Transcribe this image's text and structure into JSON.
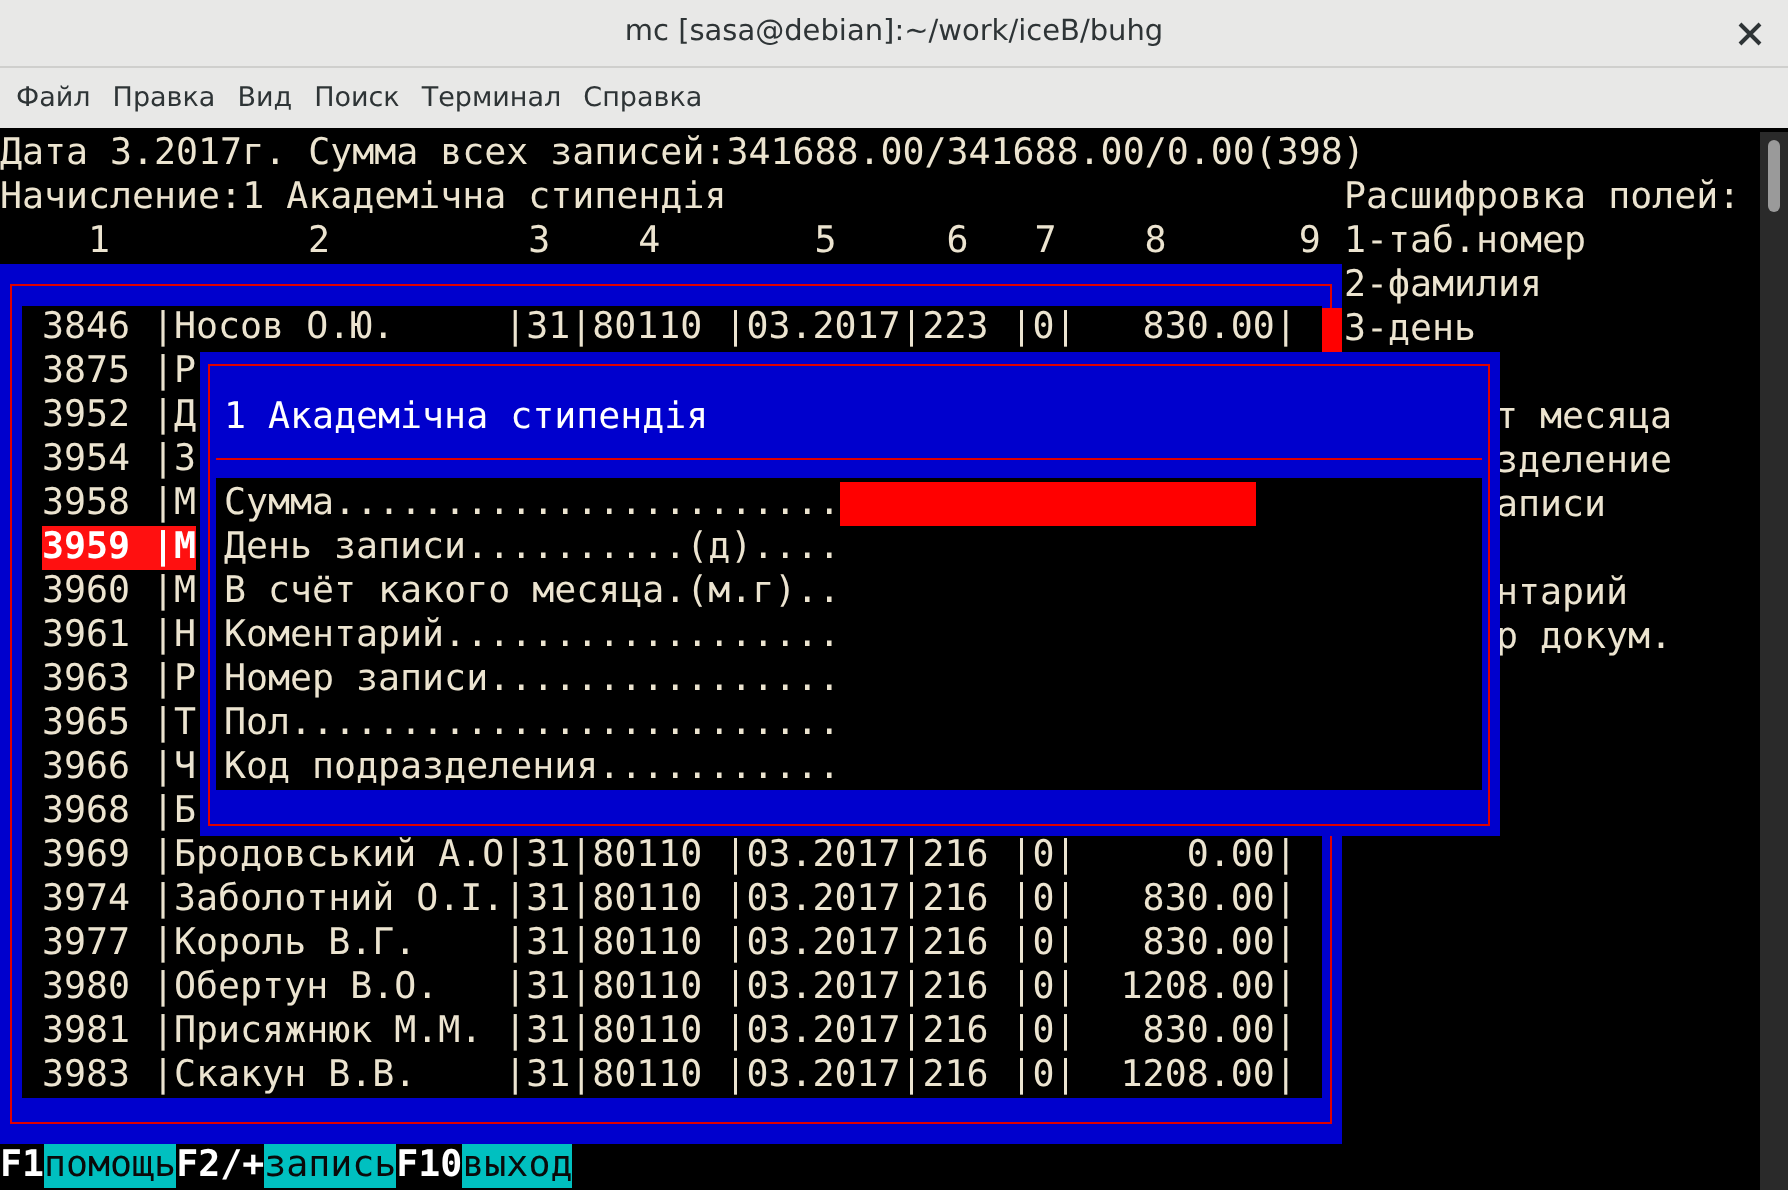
{
  "window": {
    "title": "mc [sasa@debian]:~/work/iceB/buhg"
  },
  "menu": [
    {
      "label": "Файл"
    },
    {
      "label": "Правка"
    },
    {
      "label": "Вид"
    },
    {
      "label": "Поиск"
    },
    {
      "label": "Терминал"
    },
    {
      "label": "Справка"
    }
  ],
  "terminal": {
    "summary": "Дата 3.2017г. Сумма всех записей:341688.00/341688.00/0.00(398)",
    "accrual": "Начисление:1 Академічна стипендія",
    "column_numbers": "1         2         3    4       5     6   7    8      9",
    "legend": [
      {
        "text": "Расшифровка полей:",
        "kind": "full"
      },
      {
        "text": "1-таб.номер",
        "kind": "full"
      },
      {
        "text": "2-фамилия",
        "kind": "full"
      },
      {
        "text": "3-день",
        "kind": "full"
      },
      {
        "text": "т месяца",
        "kind": "clipped"
      },
      {
        "text": "зделение",
        "kind": "clipped"
      },
      {
        "text": "аписи",
        "kind": "clipped"
      },
      {
        "text": "нтарий",
        "kind": "clipped"
      },
      {
        "text": "р докум.",
        "kind": "clipped"
      }
    ],
    "rows": [
      {
        "text": "3846 |Носов О.Ю.     |31|80110 |03.2017|223 |0|   830.00|",
        "selected": false
      },
      {
        "text": "3875 |Р",
        "selected": false
      },
      {
        "text": "3952 |Д",
        "selected": false
      },
      {
        "text": "3954 |З",
        "selected": false
      },
      {
        "text": "3958 |М",
        "selected": false
      },
      {
        "text": "3959 |М",
        "selected": true
      },
      {
        "text": "3960 |М",
        "selected": false
      },
      {
        "text": "3961 |Н",
        "selected": false
      },
      {
        "text": "3963 |Р",
        "selected": false
      },
      {
        "text": "3965 |Т",
        "selected": false
      },
      {
        "text": "3966 |Ч",
        "selected": false
      },
      {
        "text": "3968 |Б",
        "selected": false
      },
      {
        "text": "3969 |Бродовський А.О|31|80110 |03.2017|216 |0|     0.00|",
        "selected": false
      },
      {
        "text": "3974 |Заболотний О.І.|31|80110 |03.2017|216 |0|   830.00|",
        "selected": false
      },
      {
        "text": "3977 |Король В.Г.    |31|80110 |03.2017|216 |0|   830.00|",
        "selected": false
      },
      {
        "text": "3980 |Обертун В.О.   |31|80110 |03.2017|216 |0|  1208.00|",
        "selected": false
      },
      {
        "text": "3981 |Присяжнюк М.М. |31|80110 |03.2017|216 |0|   830.00|",
        "selected": false
      },
      {
        "text": "3983 |Скакун В.В.    |31|80110 |03.2017|216 |0|  1208.00|",
        "selected": false
      }
    ]
  },
  "dialog": {
    "title": "1 Академічна стипендія",
    "fields": [
      {
        "label": "Сумма.......................",
        "focused": true
      },
      {
        "label": "День записи..........(д)....",
        "focused": false
      },
      {
        "label": "В счёт какого месяца.(м.г)..",
        "focused": false
      },
      {
        "label": "Коментарий..................",
        "focused": false
      },
      {
        "label": "Номер записи................",
        "focused": false
      },
      {
        "label": "Пол.........................",
        "focused": false
      },
      {
        "label": "Код подразделения...........",
        "focused": false
      }
    ]
  },
  "function_keys": [
    {
      "key": "F1",
      "action": "помощь"
    },
    {
      "key": "F2/+",
      "action": "запись"
    },
    {
      "key": "F10",
      "action": "выход"
    }
  ]
}
